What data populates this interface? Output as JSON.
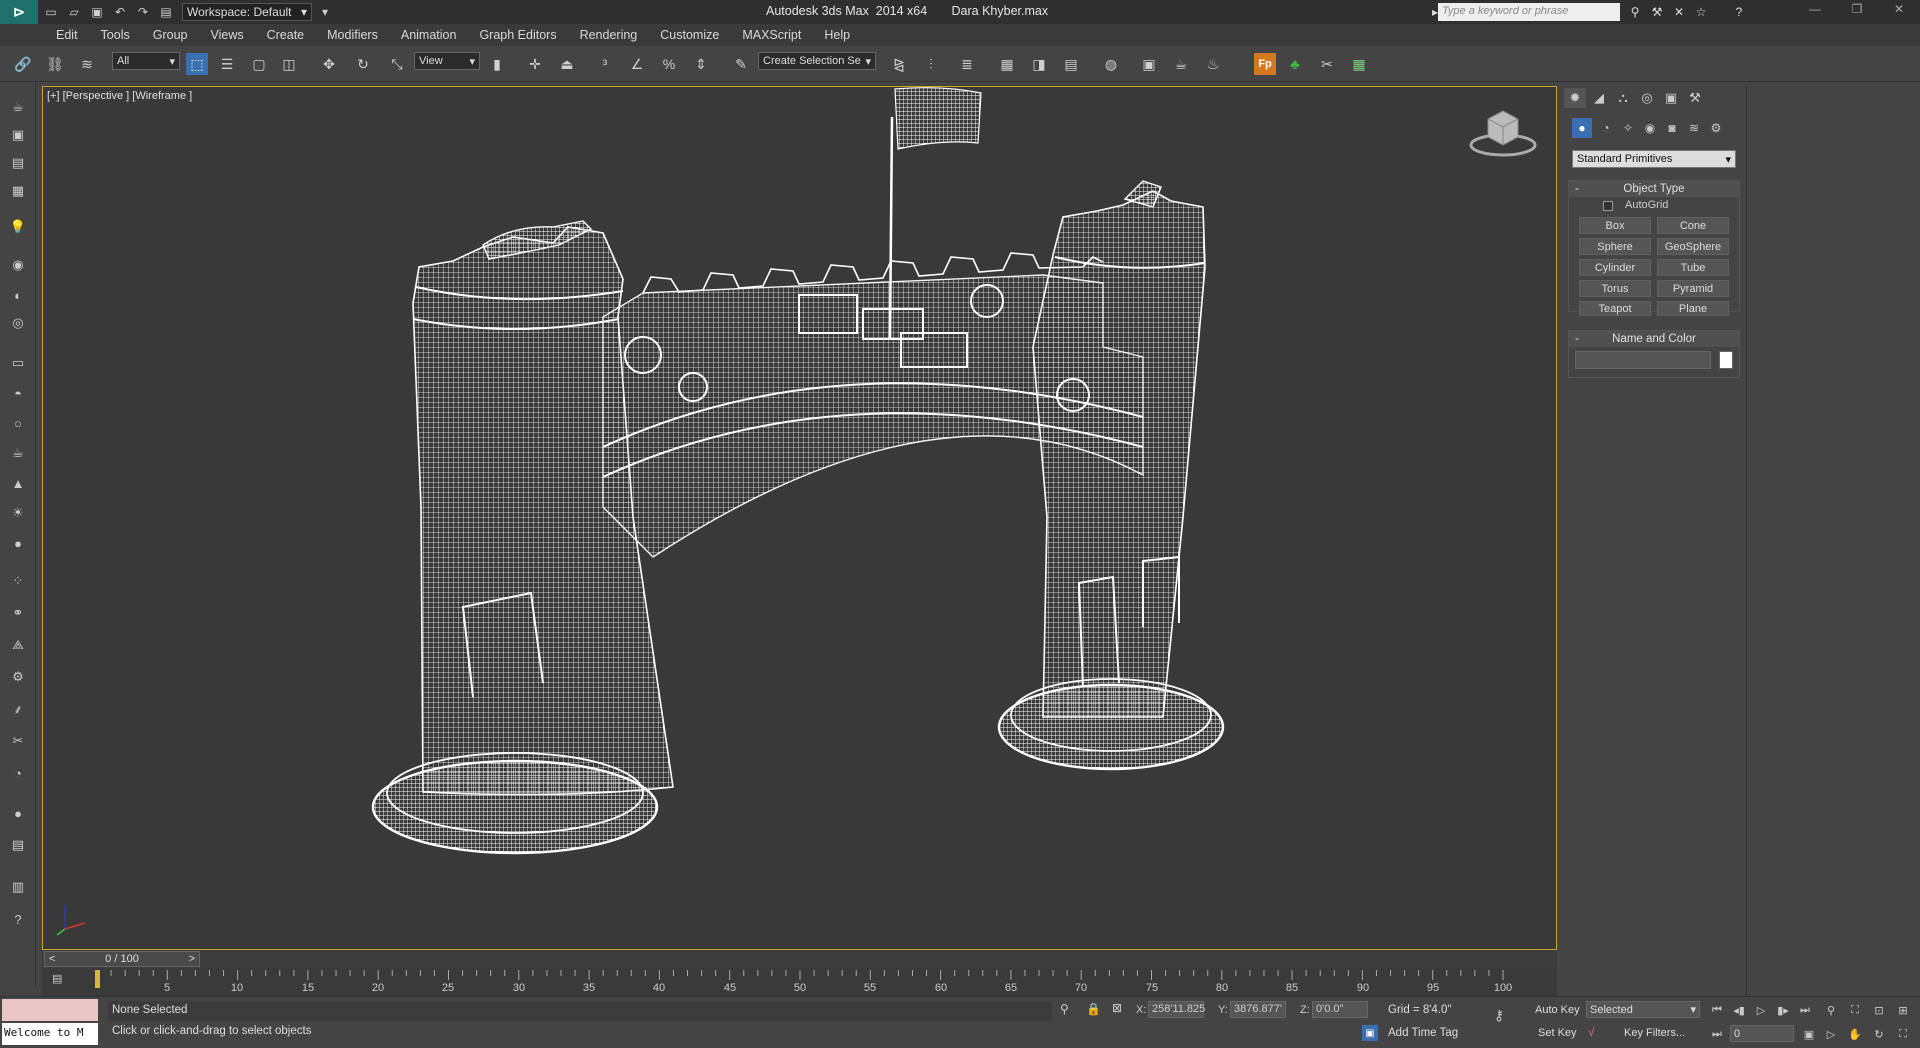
{
  "titlebar": {
    "workspace": "Workspace: Default",
    "title": "Autodesk 3ds Max  2014 x64       Dara Khyber.max",
    "search_placeholder": "Type a keyword or phrase"
  },
  "menu": [
    "Edit",
    "Tools",
    "Group",
    "Views",
    "Create",
    "Modifiers",
    "Animation",
    "Graph Editors",
    "Rendering",
    "Customize",
    "MAXScript",
    "Help"
  ],
  "toolbar": {
    "filter": "All",
    "ref_coord": "View",
    "named_selection": "Create Selection Se"
  },
  "viewport": {
    "label": "[+] [Perspective ] [Wireframe ]"
  },
  "timeslider": {
    "position": "0 / 100"
  },
  "trackbar": {
    "ticks": [
      "5",
      "10",
      "15",
      "20",
      "25",
      "30",
      "35",
      "40",
      "45",
      "50",
      "55",
      "60",
      "65",
      "70",
      "75",
      "80",
      "85",
      "90",
      "95",
      "100"
    ]
  },
  "command_panel": {
    "primitive_type": "Standard Primitives",
    "object_type_title": "Object Type",
    "autogrid_label": "AutoGrid",
    "objects": [
      "Box",
      "Cone",
      "Sphere",
      "GeoSphere",
      "Cylinder",
      "Tube",
      "Torus",
      "Pyramid",
      "Teapot",
      "Plane"
    ],
    "name_color_title": "Name and Color"
  },
  "status": {
    "maxscript_text": "Welcome to M",
    "selection": "None Selected",
    "prompt": "Click or click-and-drag to select objects",
    "x_label": "X:",
    "x_value": "258'11.825",
    "y_label": "Y:",
    "y_value": "3876.877'",
    "z_label": "Z:",
    "z_value": "0'0.0\"",
    "grid": "Grid = 8'4.0\"",
    "add_time_tag": "Add Time Tag",
    "auto_key": "Auto Key",
    "set_key": "Set Key",
    "key_mode": "Selected",
    "key_filters": "Key Filters...",
    "frame": "0"
  }
}
